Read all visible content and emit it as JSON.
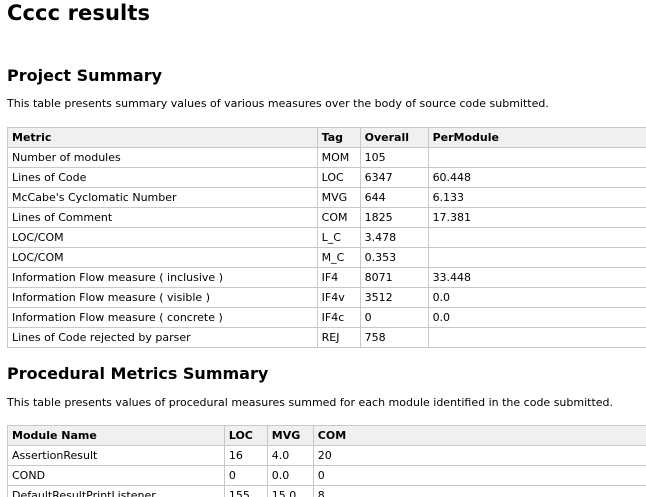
{
  "page_title": "Cccc results",
  "project_summary": {
    "heading": "Project Summary",
    "description": "This table presents summary values of various measures over the body of source code submitted.",
    "columns": [
      "Metric",
      "Tag",
      "Overall",
      "PerModule"
    ],
    "rows": [
      [
        "Number of modules",
        "MOM",
        "105",
        ""
      ],
      [
        "Lines of Code",
        "LOC",
        "6347",
        "60.448"
      ],
      [
        "McCabe's Cyclomatic Number",
        "MVG",
        "644",
        "6.133"
      ],
      [
        "Lines of Comment",
        "COM",
        "1825",
        "17.381"
      ],
      [
        "LOC/COM",
        "L_C",
        "3.478",
        ""
      ],
      [
        "LOC/COM",
        "M_C",
        "0.353",
        ""
      ],
      [
        "Information Flow measure ( inclusive )",
        "IF4",
        "8071",
        "33.448"
      ],
      [
        "Information Flow measure ( visible )",
        "IF4v",
        "3512",
        "0.0"
      ],
      [
        "Information Flow measure ( concrete )",
        "IF4c",
        "0",
        "0.0"
      ],
      [
        "Lines of Code rejected by parser",
        "REJ",
        "758",
        ""
      ]
    ]
  },
  "procedural_summary": {
    "heading": "Procedural Metrics Summary",
    "description": "This table presents values of procedural measures summed for each module identified in the code submitted.",
    "columns": [
      "Module Name",
      "LOC",
      "MVG",
      "COM"
    ],
    "rows": [
      [
        "AssertionResult",
        "16",
        "4.0",
        "20"
      ],
      [
        "COND",
        "0",
        "0.0",
        "0"
      ],
      [
        "DefaultResultPrintListener",
        "155",
        "15.0",
        "8"
      ]
    ]
  }
}
